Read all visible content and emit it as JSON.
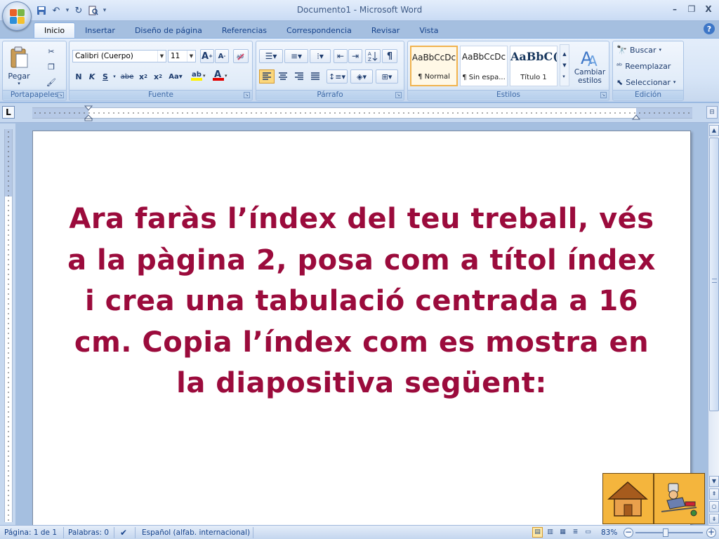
{
  "window": {
    "title": "Documento1 - Microsoft Word",
    "controls": {
      "minimize": "–",
      "restore": "❐",
      "close": "X"
    }
  },
  "tabs": [
    "Inicio",
    "Insertar",
    "Diseño de página",
    "Referencias",
    "Correspondencia",
    "Revisar",
    "Vista"
  ],
  "ribbon": {
    "clipboard": {
      "label": "Portapapeles",
      "paste": "Pegar"
    },
    "font": {
      "label": "Fuente",
      "font_name": "Calibri (Cuerpo)",
      "font_size": "11"
    },
    "paragraph": {
      "label": "Párrafo"
    },
    "styles": {
      "label": "Estilos",
      "items": [
        {
          "sample": "AaBbCcDc",
          "name": "¶ Normal"
        },
        {
          "sample": "AaBbCcDc",
          "name": "¶ Sin espa..."
        },
        {
          "sample": "AaBbC(",
          "name": "Título 1"
        }
      ],
      "change_styles": "Cambiar estilos"
    },
    "editing": {
      "label": "Edición",
      "find": "Buscar",
      "replace": "Reemplazar",
      "select": "Seleccionar"
    }
  },
  "ruler": {
    "tab_selector": "L"
  },
  "document": {
    "text": "Ara faràs l’índex del teu treball, vés a la pàgina 2, posa com a títol índex i crea una tabulació centrada a 16 cm. Copia l’índex com es mostra en la diapositiva següent:"
  },
  "statusbar": {
    "page": "Página: 1 de 1",
    "words": "Palabras: 0",
    "language": "Español (alfab. internacional)",
    "zoom": "83%"
  }
}
